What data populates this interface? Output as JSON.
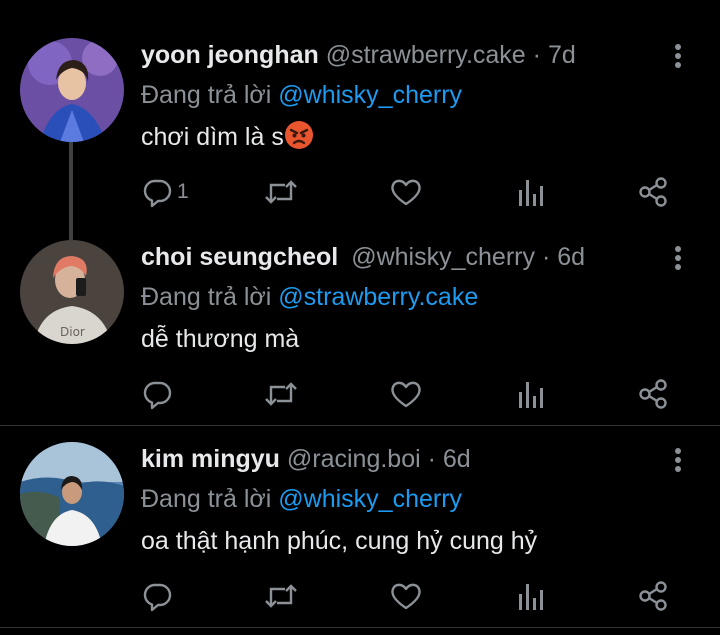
{
  "tweets": [
    {
      "name": "yoon jeonghan",
      "handle": "@strawberry.cake",
      "dot": "·",
      "time": "7d",
      "reply_prefix": "Đang trả lời ",
      "reply_to": "@whisky_cherry",
      "text": "chơi dìm là s",
      "emoji": "angry-face-emoji",
      "reply_count": "1"
    },
    {
      "name": "choi seungcheol",
      "handle": "@whisky_cherry",
      "dot": "·",
      "time": "6d",
      "reply_prefix": "Đang trả lời ",
      "reply_to": "@strawberry.cake",
      "text": "dễ thương mà",
      "reply_count": ""
    },
    {
      "name": "kim mingyu",
      "handle": "@racing.boi",
      "dot": "·",
      "time": "6d",
      "reply_prefix": "Đang trả lời ",
      "reply_to": "@whisky_cherry",
      "text": "oa thật hạnh phúc, cung hỷ cung hỷ",
      "reply_count": ""
    }
  ],
  "icons": {
    "reply": "reply-icon",
    "retweet": "retweet-icon",
    "like": "heart-icon",
    "analytics": "analytics-icon",
    "share": "share-icon",
    "more": "more-vertical-icon"
  },
  "colors": {
    "background": "#000000",
    "text": "#e7e9ea",
    "muted": "#8b9196",
    "mention": "#1d9bf0",
    "thread_line": "#3e4144"
  }
}
